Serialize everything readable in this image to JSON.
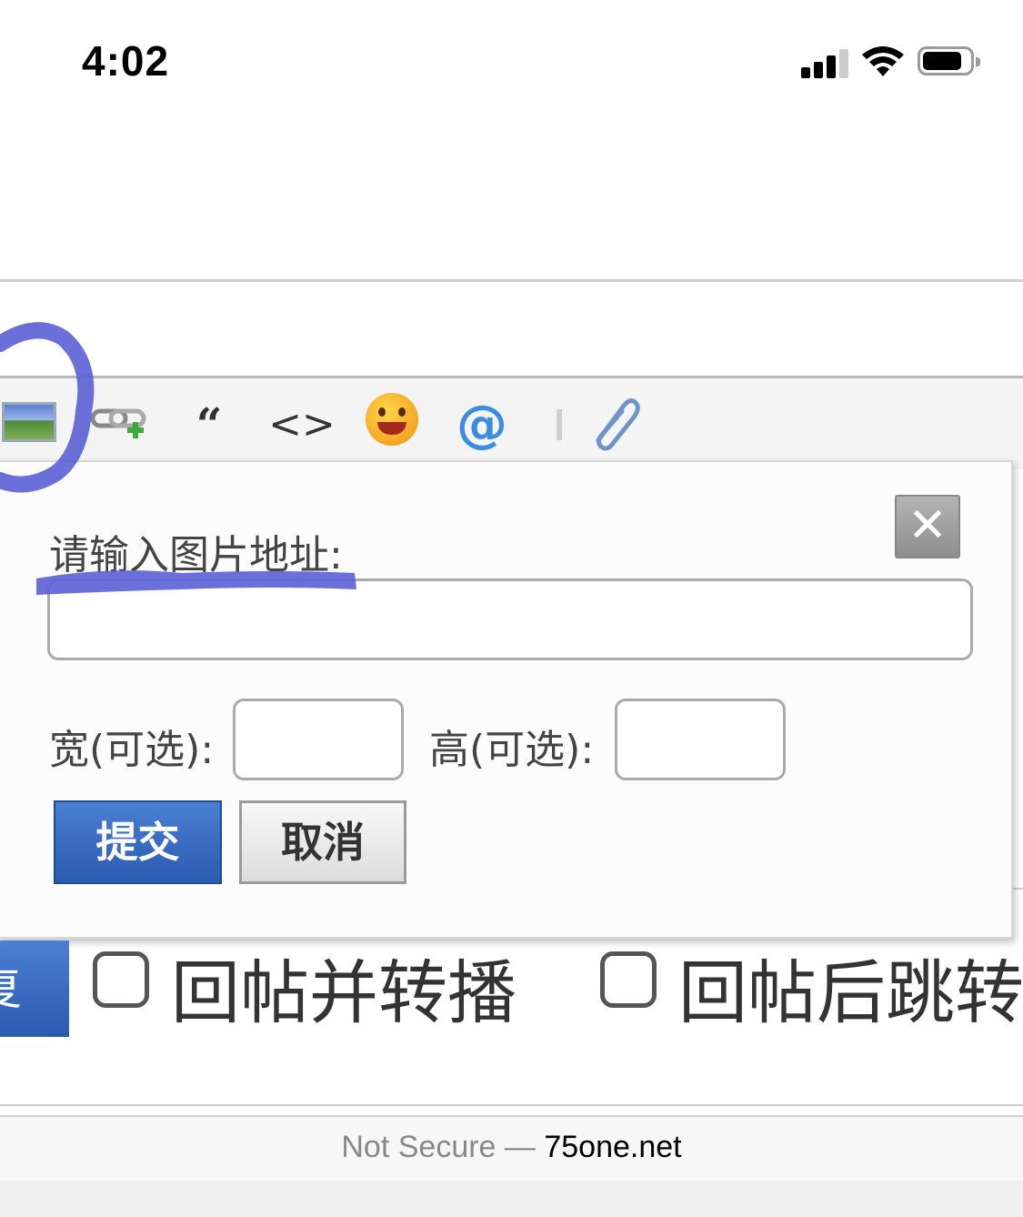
{
  "status_bar": {
    "time": "4:02"
  },
  "toolbar": {
    "icons": [
      "image-icon",
      "link-add-icon",
      "quote-icon",
      "code-icon",
      "smiley-icon",
      "at-icon",
      "separator",
      "paperclip-icon"
    ],
    "quote_glyph": "“",
    "code_glyph": "<>",
    "at_glyph": "@",
    "clip_glyph": "📎"
  },
  "dialog": {
    "prompt": "请输入图片地址:",
    "url_value": "",
    "width_label": "宽(可选):",
    "height_label": "高(可选):",
    "width_value": "",
    "height_value": "",
    "close_glyph": "✕",
    "submit_label": "提交",
    "cancel_label": "取消"
  },
  "bottom": {
    "reply_label": "复",
    "option1_label": "回帖并转播",
    "option2_label": "回帖后跳转"
  },
  "browser": {
    "security": "Not Secure — ",
    "domain": "75one.net"
  },
  "colors": {
    "accent_blue": "#2a5bb0",
    "annotation": "#5a5fd6"
  }
}
